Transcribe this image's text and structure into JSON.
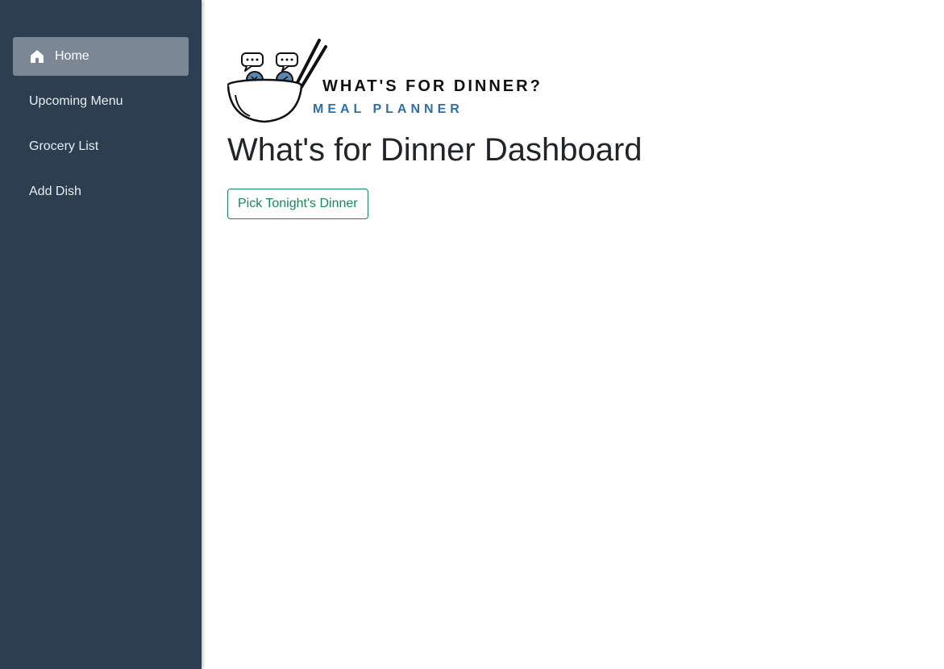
{
  "sidebar": {
    "items": [
      {
        "label": "Home",
        "icon": "home-icon",
        "active": true
      },
      {
        "label": "Upcoming Menu",
        "icon": "",
        "active": false
      },
      {
        "label": "Grocery List",
        "icon": "",
        "active": false
      },
      {
        "label": "Add Dish",
        "icon": "",
        "active": false
      }
    ]
  },
  "logo": {
    "line1": "WHAT'S FOR DINNER?",
    "line2": "MEAL PLANNER"
  },
  "main": {
    "title": "What's for Dinner Dashboard",
    "pick_button_label": "Pick Tonight's Dinner"
  },
  "colors": {
    "sidebar_bg": "#2c3e50",
    "active_item_bg": "#7b8794",
    "button_accent": "#198754",
    "logo_blue": "#2f6fa3"
  }
}
